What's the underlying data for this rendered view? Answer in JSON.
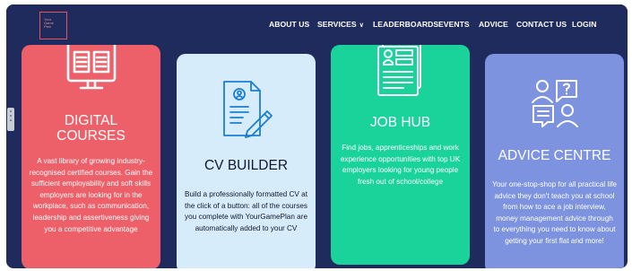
{
  "brand": {
    "logo_text": "Your Game Plan"
  },
  "nav": {
    "about": "ABOUT US",
    "services": "SERVICES",
    "leaderboards": "LEADERBOARDS",
    "events": "EVENTS",
    "advice": "ADVICE",
    "contact": "CONTACT US",
    "login": "LOGIN"
  },
  "cards": {
    "courses": {
      "title_line1": "DIGITAL",
      "title_line2": "COURSES",
      "description": "A vast library of growing industry-recognised certified courses. Gain the sufficient employability and soft skills employers are looking for in the workplace, such as communication, leadership and assertiveness giving you a competitive advantage",
      "icon": "laptop-book-icon"
    },
    "cv": {
      "title": "CV BUILDER",
      "description": "Build a professionally formatted CV at the click of a button: all of the courses you complete with YourGamePlan are automatically added to your CV",
      "icon": "cv-document-pencil-icon"
    },
    "job": {
      "title": "JOB HUB",
      "description": "Find jobs, apprenticeships and work experience opportunities with top UK employers looking for young people fresh out of school/college",
      "icon": "job-listing-icon"
    },
    "advice": {
      "title": "ADVICE CENTRE",
      "description": "Your one-stop-shop for all practical life advice they don't teach you at school from how to ace a job interview, money management advice through to everything you need to know about getting your first flat and more!",
      "icon": "advice-chat-icon"
    }
  },
  "colors": {
    "navy": "#1e2b5c",
    "courses": "#ee6069",
    "cv": "#d7ecfb",
    "job": "#1ad39b",
    "advice": "#7d93df"
  }
}
